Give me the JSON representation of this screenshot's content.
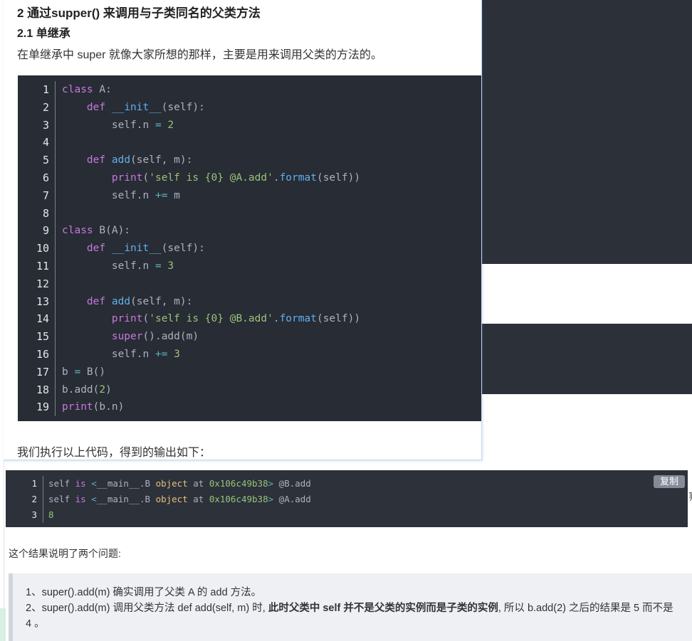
{
  "article": {
    "heading2": "2 通过supper() 来调用与子类同名的父类方法",
    "heading3": "2.1 单继承",
    "intro": "在单继承中 super 就像大家所想的那样，主要是用来调用父类的方法的。",
    "after_code": "我们执行以上代码，得到的输出如下："
  },
  "code1": {
    "line_numbers": [
      "1",
      "2",
      "3",
      "4",
      "5",
      "6",
      "7",
      "8",
      "9",
      "10",
      "11",
      "12",
      "13",
      "14",
      "15",
      "16",
      "17",
      "18",
      "19"
    ]
  },
  "code2": {
    "copy_label": "复制",
    "line_numbers": [
      "1",
      "2",
      "3"
    ]
  },
  "result": {
    "intro": "这个结果说明了两个问题:",
    "item1": "1、super().add(m) 确实调用了父类 A 的 add 方法。",
    "item2_pre": "2、super().add(m) 调用父类方法 def add(self, m) 时, ",
    "item2_bold": "此时父类中 self 并不是父类的实例而是子类的实例",
    "item2_post": ", 所以 b.add(2) 之后的结果是 5 而不是 4 。"
  },
  "misc": {
    "right_edge_glyph": "测"
  },
  "colors": {
    "code_bg": "#282c34",
    "keyword": "#c678dd",
    "function": "#61afef",
    "number": "#98c379",
    "operator": "#56b6c2",
    "string": "#98c379"
  }
}
